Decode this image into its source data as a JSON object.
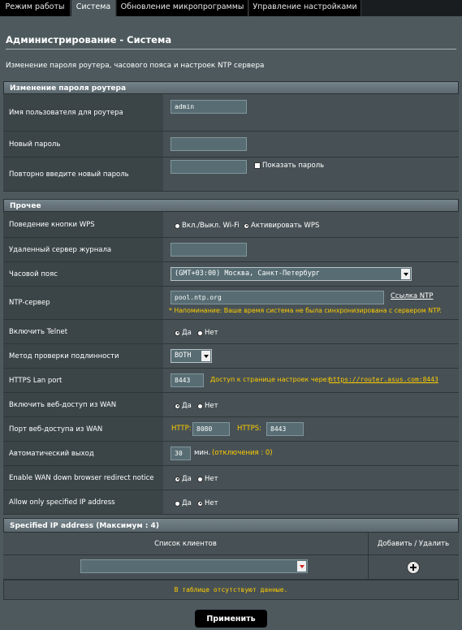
{
  "tabs": [
    {
      "label": "Режим работы"
    },
    {
      "label": "Система"
    },
    {
      "label": "Обновление микропрограммы"
    },
    {
      "label": "Управление настройками"
    }
  ],
  "page": {
    "title": "Администрирование - Система",
    "subtitle": "Изменение пароля роутера, часового пояса и настроек NTP сервера"
  },
  "password_section": {
    "header": "Изменение пароля роутера",
    "username_label": "Имя пользователя для роутера",
    "username_value": "admin",
    "new_password_label": "Новый пароль",
    "new_password_value": "",
    "repeat_password_label": "Повторно введите новый пароль",
    "repeat_password_value": "",
    "show_password_label": "Показать пароль"
  },
  "misc_section": {
    "header": "Прочее",
    "wps_label": "Поведение кнопки WPS",
    "wps_option1": "Вкл./Выкл. Wi-Fi",
    "wps_option2": "Активировать WPS",
    "syslog_label": "Удаленный сервер журнала",
    "syslog_value": "",
    "timezone_label": "Часовой пояс",
    "timezone_value": "(GMT+03:00) Москва, Санкт-Петербург",
    "ntp_label": "NTP-сервер",
    "ntp_value": "pool.ntp.org",
    "ntp_link": "Ссылка NTP",
    "ntp_note": "* Напоминание: Ваше время система не была синхронизирована с сервером NTP.",
    "telnet_label": "Включить Telnet",
    "auth_label": "Метод проверки подлинности",
    "auth_value": "BOTH",
    "https_label": "HTTPS Lan port",
    "https_value": "8443",
    "https_note": "Доступ к странице настроек через",
    "https_link": "https://router.asus.com:8443",
    "wan_access_label": "Включить веб-доступ из WAN",
    "wan_port_label": "Порт веб-доступа из WAN",
    "wan_http_label": "HTTP:",
    "wan_http_value": "8080",
    "wan_https_label": "HTTPS:",
    "wan_https_value": "8443",
    "autologout_label": "Автоматический выход",
    "autologout_value": "30",
    "autologout_unit": "мин.",
    "autologout_note": "(отключения : 0)",
    "redirect_label": "Enable WAN down browser redirect notice",
    "allow_ip_label": "Allow only specified IP address",
    "yes": "Да",
    "no": "Нет"
  },
  "ip_section": {
    "header": "Specified IP address (Максимум : 4)",
    "col_clients": "Список клиентов",
    "col_add": "Добавить / Удалить",
    "client_value": "",
    "empty": "В таблице отсутствуют данные."
  },
  "apply_label": "Применить"
}
